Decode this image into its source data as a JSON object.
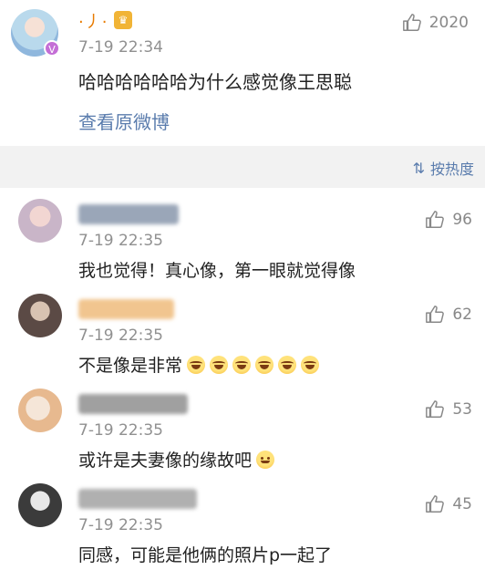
{
  "post": {
    "username": "·丿·",
    "time": "7-19 22:34",
    "likes": "2020",
    "text": "哈哈哈哈哈哈为什么感觉像王思聪",
    "view_original": "查看原微博",
    "avatar_icon": "anime-avatar",
    "badge_icon": "verified-v-badge",
    "crown_icon": "crown-icon",
    "colors": {
      "username": "#e87b00",
      "link": "#5a7cad"
    }
  },
  "sort": {
    "label": "按热度",
    "icon": "sort-icon"
  },
  "comments": [
    {
      "time": "7-19 22:35",
      "likes": "96",
      "text": "我也觉得！真心像，第一眼就觉得像",
      "avatar_color": "#c9b5c8",
      "blur_color": "#9aa6b8"
    },
    {
      "time": "7-19 22:35",
      "likes": "62",
      "text": "不是像是非常",
      "emoji": 6,
      "avatar_color": "#5b4a45",
      "blur_color": "#f1c58f"
    },
    {
      "time": "7-19 22:35",
      "likes": "53",
      "text": "或许是夫妻像的缘故吧",
      "emoji_smile": 1,
      "avatar_color": "#e7b98f",
      "blur_color": "#a0a0a0"
    },
    {
      "time": "7-19 22:35",
      "likes": "45",
      "text": "同感，可能是他俩的照片p一起了",
      "avatar_color": "#3b3b3b",
      "blur_color": "#b0b0b0"
    }
  ]
}
